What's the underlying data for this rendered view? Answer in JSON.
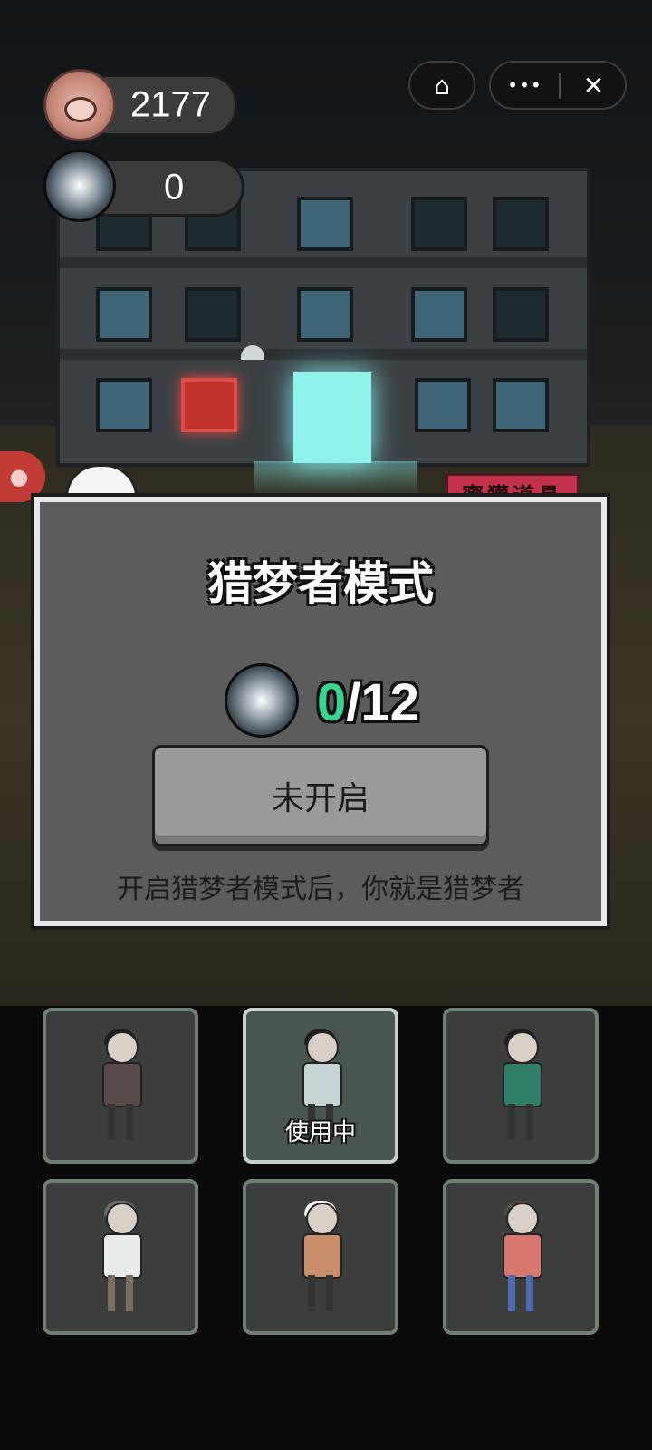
{
  "hud": {
    "coins": "2177",
    "dream_orbs": "0",
    "coin_icon": "pig-face-coin-icon",
    "dream_icon": "dream-orb-icon"
  },
  "miniapp_bar": {
    "home_icon": "⌂",
    "more_icon": "•••",
    "close_icon": "✕"
  },
  "scene": {
    "shop_sign": "蜜獾道具"
  },
  "panel": {
    "title": "猎梦者模式",
    "current": "0",
    "total": "/12",
    "button_label": "未开启",
    "description": "开启猎梦者模式后，你就是猎梦者"
  },
  "characters": [
    {
      "name": "girl-twin-buns",
      "body_color": "#5a4b4b",
      "in_use": false
    },
    {
      "name": "boy-glasses",
      "body_color": "#c8d3d6",
      "in_use": true,
      "badge": "使用中"
    },
    {
      "name": "man-beard-green",
      "body_color": "#2f7f6a",
      "in_use": false
    },
    {
      "name": "woman-glasses-white",
      "body_color": "#e9ecec",
      "in_use": false
    },
    {
      "name": "granny-apron",
      "body_color": "#c98f6b",
      "in_use": false
    },
    {
      "name": "woman-red-top",
      "body_color": "#d9776f",
      "in_use": false
    }
  ]
}
